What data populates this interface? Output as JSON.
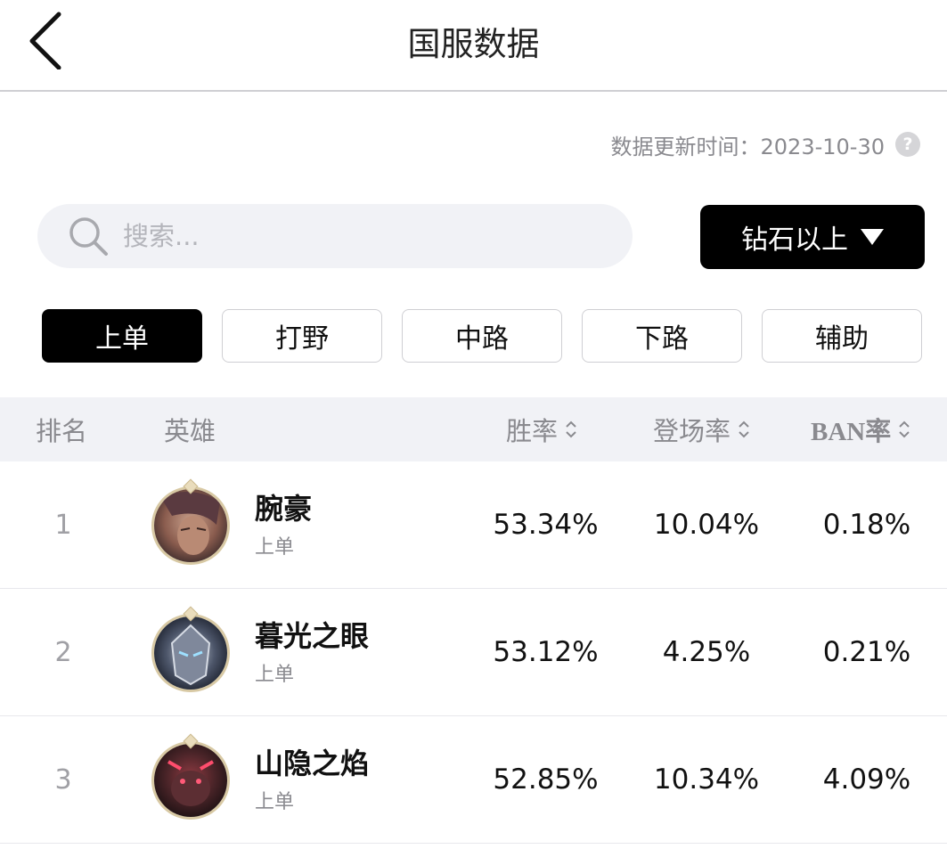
{
  "header": {
    "title": "国服数据"
  },
  "update": {
    "text": "数据更新时间：2023-10-30",
    "help_icon": "?"
  },
  "search": {
    "placeholder": "搜索..."
  },
  "rank_filter": {
    "label": "钻石以上"
  },
  "tabs": [
    {
      "label": "上单",
      "active": true
    },
    {
      "label": "打野",
      "active": false
    },
    {
      "label": "中路",
      "active": false
    },
    {
      "label": "下路",
      "active": false
    },
    {
      "label": "辅助",
      "active": false
    }
  ],
  "table": {
    "headers": {
      "rank": "排名",
      "hero": "英雄",
      "win_rate": "胜率",
      "pick_rate": "登场率",
      "ban_rate": "BAN率"
    },
    "rows": [
      {
        "rank": "1",
        "name": "腕豪",
        "role": "上单",
        "win_rate": "53.34%",
        "pick_rate": "10.04%",
        "ban_rate": "0.18%"
      },
      {
        "rank": "2",
        "name": "暮光之眼",
        "role": "上单",
        "win_rate": "53.12%",
        "pick_rate": "4.25%",
        "ban_rate": "0.21%"
      },
      {
        "rank": "3",
        "name": "山隐之焰",
        "role": "上单",
        "win_rate": "52.85%",
        "pick_rate": "10.34%",
        "ban_rate": "4.09%"
      }
    ]
  },
  "colors": {
    "accent": "#000000",
    "muted_text": "#8a8a8f",
    "header_bg": "#f1f2f6",
    "avatar_ring": "#d8c9a4"
  }
}
